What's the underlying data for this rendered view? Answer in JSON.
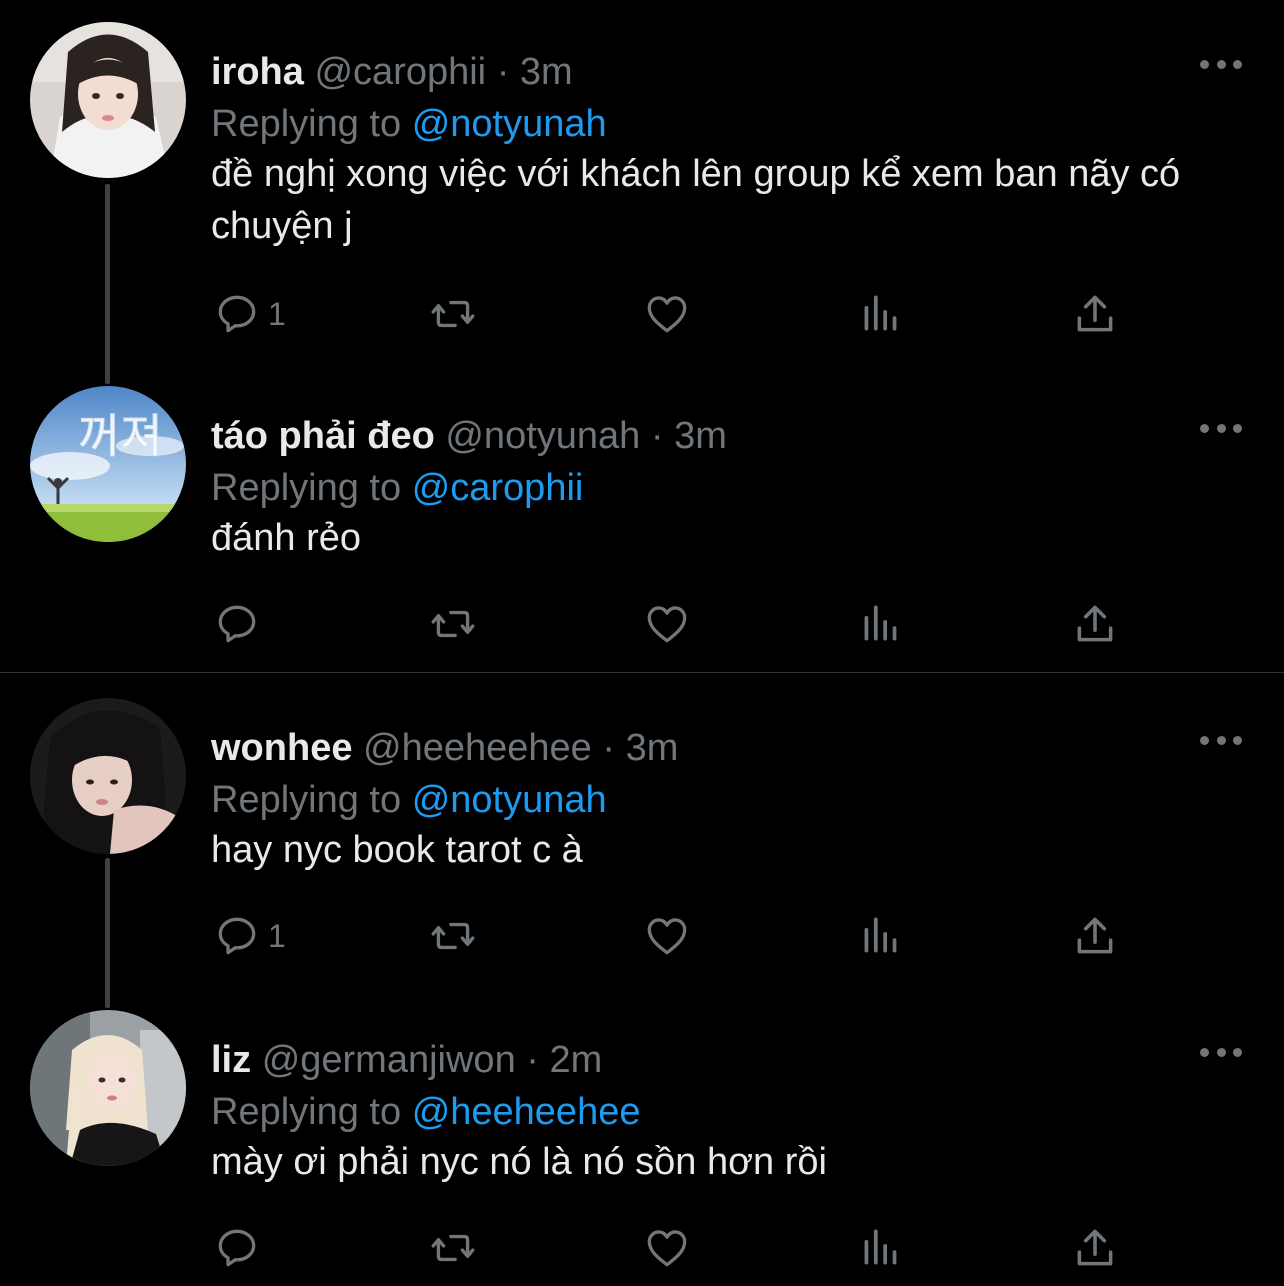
{
  "colors": {
    "background": "#000000",
    "text": "#e7e9ea",
    "muted": "#71767b",
    "accent": "#1d9bf0",
    "thread_line": "#3e4144"
  },
  "tweets": [
    {
      "name": "iroha",
      "handle": "@carophii",
      "sep": "·",
      "time": "3m",
      "replying_prefix": "Replying to",
      "replying_to": "@notyunah",
      "text": "đề nghị xong việc với khách lên group kể xem ban nãy có chuyện j",
      "reply_count": "1",
      "icons": [
        "reply-icon",
        "retweet-icon",
        "like-icon",
        "views-icon",
        "share-icon",
        "more-icon"
      ]
    },
    {
      "name": "táo phải đeo",
      "handle": "@notyunah",
      "sep": "·",
      "time": "3m",
      "replying_prefix": "Replying to",
      "replying_to": "@carophii",
      "text": "đánh rẻo",
      "reply_count": "",
      "avatar_text": "꺼져",
      "icons": [
        "reply-icon",
        "retweet-icon",
        "like-icon",
        "views-icon",
        "share-icon",
        "more-icon"
      ]
    },
    {
      "name": "wonhee",
      "handle": "@heeheehee",
      "sep": "·",
      "time": "3m",
      "replying_prefix": "Replying to",
      "replying_to": "@notyunah",
      "text": "hay nyc book tarot c à",
      "reply_count": "1",
      "icons": [
        "reply-icon",
        "retweet-icon",
        "like-icon",
        "views-icon",
        "share-icon",
        "more-icon"
      ]
    },
    {
      "name": "liz",
      "handle": "@germanjiwon",
      "sep": "·",
      "time": "2m",
      "replying_prefix": "Replying to",
      "replying_to": "@heeheehee",
      "text": "mày ơi phải nyc nó là nó sồn hơn rồi",
      "reply_count": "",
      "icons": [
        "reply-icon",
        "retweet-icon",
        "like-icon",
        "views-icon",
        "share-icon",
        "more-icon"
      ]
    }
  ]
}
